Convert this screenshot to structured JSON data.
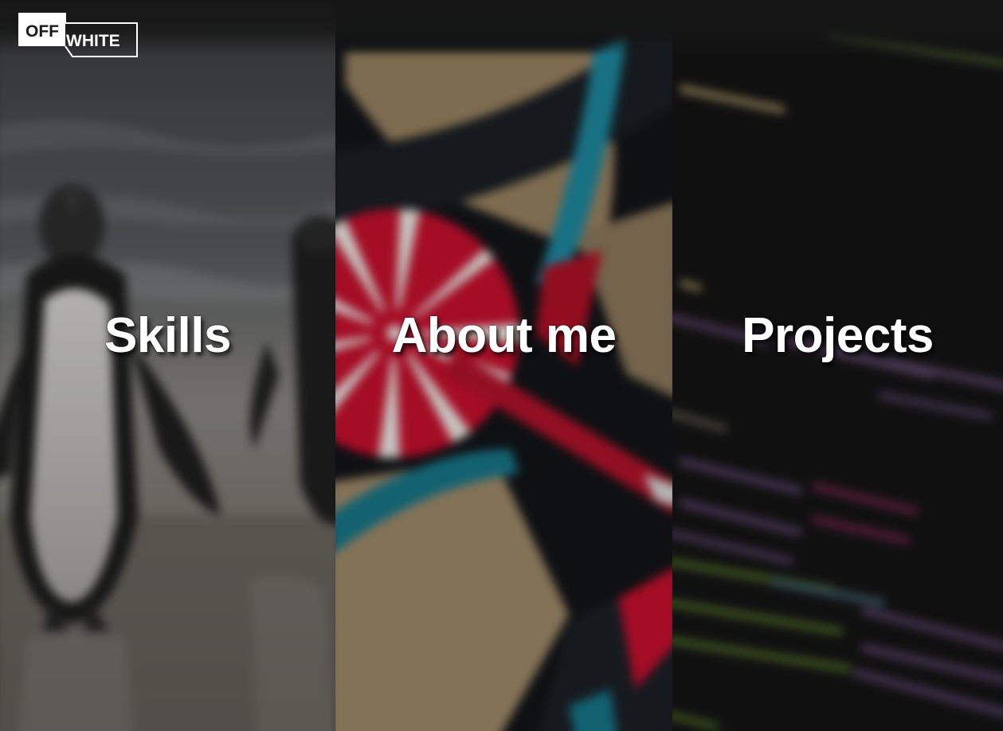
{
  "brand": {
    "logo_text_top": "OFF",
    "logo_text_bottom": "WHITE",
    "logo_color": "#ffffff",
    "logo_text_color": "#1a1a1a"
  },
  "panels": [
    {
      "id": "skills",
      "label": "Skills",
      "image_icon": "penguins-image"
    },
    {
      "id": "about",
      "label": "About me",
      "image_icon": "dartboard-image"
    },
    {
      "id": "projects",
      "label": "Projects",
      "image_icon": "code-screen-image"
    }
  ],
  "colors": {
    "background": "#151515",
    "label": "#ffffff",
    "dart_red": "#c8102e",
    "dart_teal": "#1a8a9a"
  }
}
